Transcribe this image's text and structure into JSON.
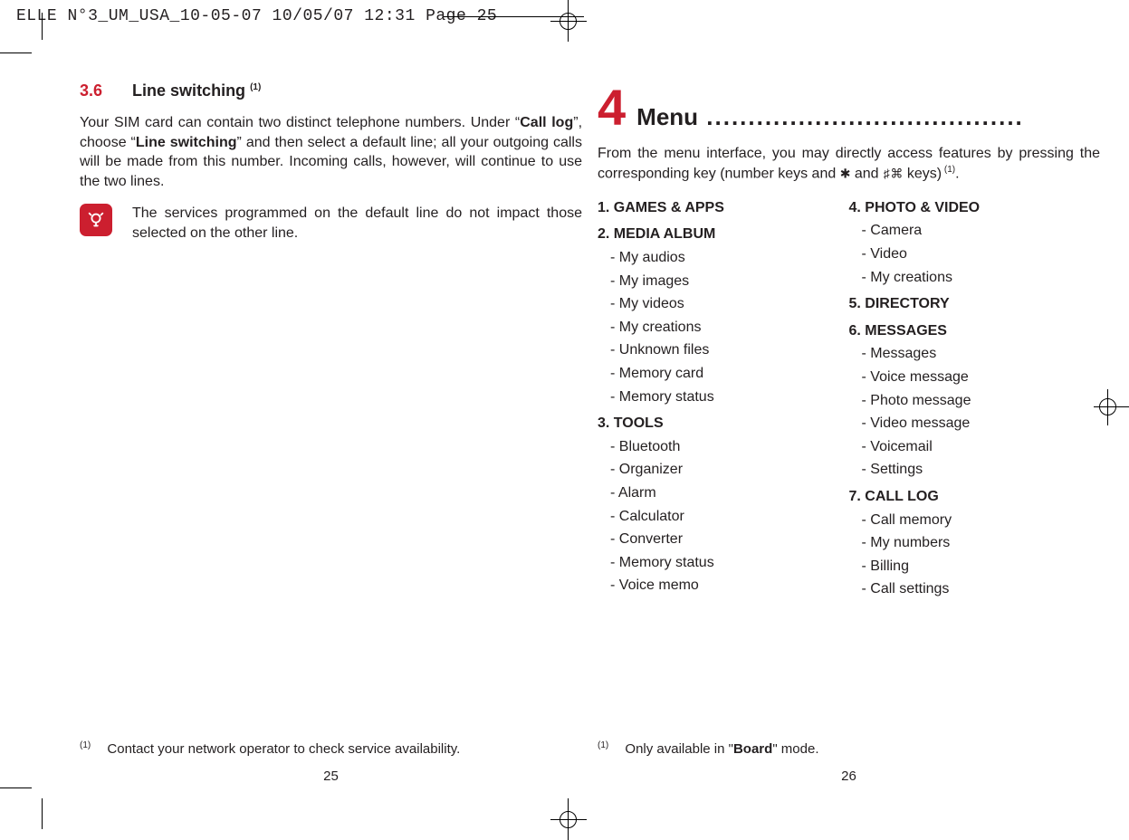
{
  "print_header": "ELLE N°3_UM_USA_10-05-07  10/05/07  12:31  Page 25",
  "left": {
    "section_number": "3.6",
    "section_title": "Line switching",
    "section_sup": "(1)",
    "para_a": "Your SIM card can contain two distinct telephone numbers. Under “",
    "para_bold1": "Call log",
    "para_b": "”, choose “",
    "para_bold2": "Line switching",
    "para_c": "” and then select a default line; all your outgoing calls will be made from this number. Incoming calls, however, will continue to use the two lines.",
    "note": "The services programmed on the default line do not impact those selected on the other line.",
    "footnote_mark": "(1)",
    "footnote_text": "Contact your network operator to check service availability.",
    "page_number": "25"
  },
  "right": {
    "chapter_number": "4",
    "chapter_title": "Menu",
    "chapter_dots": " ......................................",
    "intro_a": "From the menu interface, you may directly access features by pressing the corresponding key (number keys and ",
    "intro_key1": "✱",
    "intro_mid": " and ",
    "intro_key2": "♯⌘",
    "intro_b": " keys)",
    "intro_sup": " (1)",
    "intro_end": ".",
    "col1": [
      {
        "head": "1. GAMES & APPS"
      },
      {
        "head": "2. MEDIA ALBUM"
      },
      {
        "sub": "My audios"
      },
      {
        "sub": "My images"
      },
      {
        "sub": "My videos"
      },
      {
        "sub": "My creations"
      },
      {
        "sub": "Unknown files"
      },
      {
        "sub": "Memory card"
      },
      {
        "sub": "Memory status"
      },
      {
        "head": "3. TOOLS"
      },
      {
        "sub": "Bluetooth"
      },
      {
        "sub": "Organizer"
      },
      {
        "sub": "Alarm"
      },
      {
        "sub": "Calculator"
      },
      {
        "sub": "Converter"
      },
      {
        "sub": "Memory status"
      },
      {
        "sub": "Voice memo"
      }
    ],
    "col2": [
      {
        "head": "4. PHOTO & VIDEO"
      },
      {
        "sub": "Camera"
      },
      {
        "sub": "Video"
      },
      {
        "sub": "My creations"
      },
      {
        "head": "5. DIRECTORY"
      },
      {
        "head": "6. MESSAGES"
      },
      {
        "sub": "Messages"
      },
      {
        "sub": "Voice message"
      },
      {
        "sub": "Photo message"
      },
      {
        "sub": "Video message"
      },
      {
        "sub": "Voicemail"
      },
      {
        "sub": "Settings"
      },
      {
        "head": "7. CALL LOG"
      },
      {
        "sub": "Call memory"
      },
      {
        "sub": "My numbers"
      },
      {
        "sub": "Billing"
      },
      {
        "sub": "Call settings"
      }
    ],
    "footnote_mark": "(1)",
    "footnote_a": "Only available in \"",
    "footnote_bold": "Board",
    "footnote_b": "\" mode.",
    "page_number": "26"
  }
}
